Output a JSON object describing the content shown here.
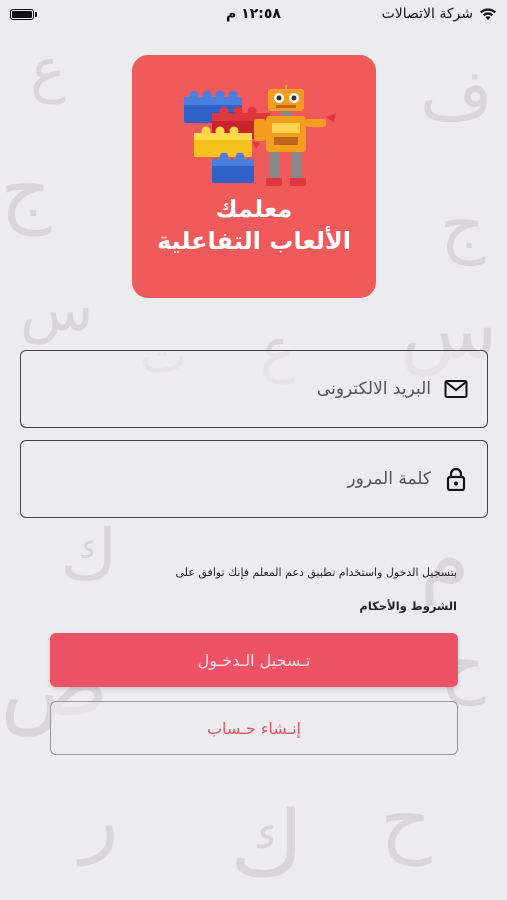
{
  "status_bar": {
    "carrier": "شركة الاتصالات",
    "time": "١٢:٥٨ م"
  },
  "logo": {
    "title_line1": "معلمك",
    "title_line2": "الألعاب التفاعلية"
  },
  "form": {
    "email_placeholder": "البريد الالكترونى",
    "password_placeholder": "كلمة المرور"
  },
  "terms": {
    "notice": "بتسجيل الدخول واستخدام تطبيق دعم المعلم فإنك توافق على",
    "link": "الشروط والأحكام"
  },
  "buttons": {
    "login": "تـسجيل الـدخـول",
    "register": "إنـشاء حـساب"
  },
  "colors": {
    "accent": "#ef5165",
    "logo_bg": "#f05a5b",
    "background": "#ecebee"
  }
}
